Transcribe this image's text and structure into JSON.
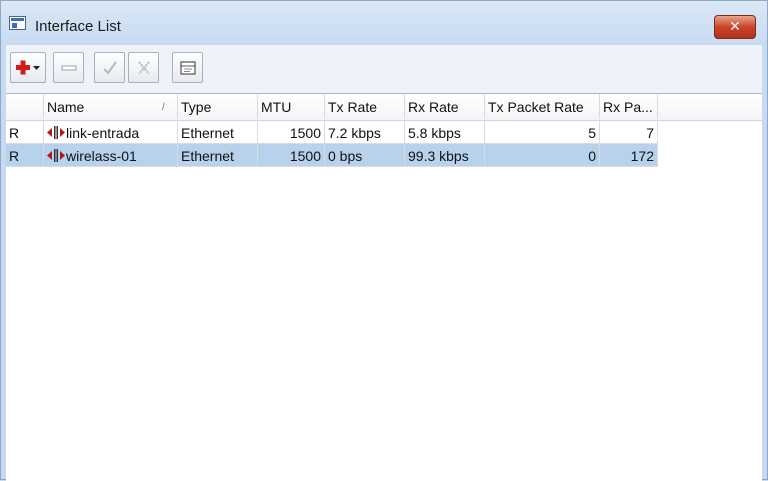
{
  "window": {
    "title": "Interface List",
    "close_label": "✕"
  },
  "toolbar": {
    "buttons": [
      {
        "name": "add",
        "icon": "plus-icon",
        "color": "#d11a1a"
      },
      {
        "name": "remove",
        "icon": "minus-icon"
      },
      {
        "name": "enable",
        "icon": "check-icon"
      },
      {
        "name": "disable",
        "icon": "cross-icon"
      },
      {
        "name": "comment",
        "icon": "note-icon"
      }
    ]
  },
  "table": {
    "columns": [
      "",
      "Name",
      "Type",
      "MTU",
      "Tx Rate",
      "Rx Rate",
      "Tx Packet Rate",
      "Rx Pa..."
    ],
    "sort_indicator": "/",
    "rows": [
      {
        "flag": "R",
        "name": "link-entrada",
        "type": "Ethernet",
        "mtu": "1500",
        "tx_rate": "7.2 kbps",
        "rx_rate": "5.8 kbps",
        "tx_packet_rate": "5",
        "rx_packet_rate": "7",
        "selected": false
      },
      {
        "flag": "R",
        "name": "wirelass-01",
        "type": "Ethernet",
        "mtu": "1500",
        "tx_rate": "0 bps",
        "rx_rate": "99.3 kbps",
        "tx_packet_rate": "0",
        "rx_packet_rate": "172",
        "selected": true
      }
    ]
  },
  "colors": {
    "selection": "#b8d2ec",
    "close_button": "#c8452a"
  }
}
